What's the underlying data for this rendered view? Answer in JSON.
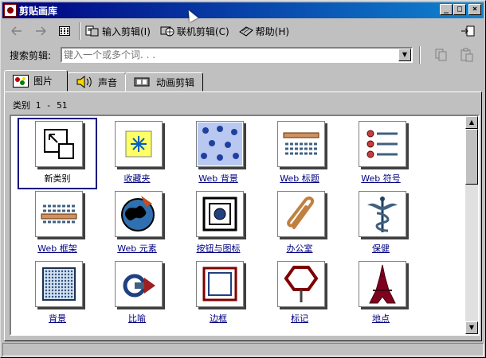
{
  "window": {
    "title": "剪贴画库"
  },
  "title_buttons": {
    "minimize": "_",
    "maximize": "□",
    "close": "×"
  },
  "toolbar": {
    "back_icon": "arrow-left-icon",
    "forward_icon": "arrow-right-icon",
    "thumbnails_icon": "grid-icon",
    "import_label": "输入剪辑(I)",
    "online_label": "联机剪辑(C)",
    "help_label": "帮助(H)",
    "pin_icon": "pin-icon"
  },
  "search": {
    "label": "搜索剪辑:",
    "placeholder": "键入一个或多个词. . ."
  },
  "tabs": [
    {
      "label": "图片"
    },
    {
      "label": "声音"
    },
    {
      "label": "动画剪辑"
    }
  ],
  "panel": {
    "category_label": "类别 1 - 51"
  },
  "categories": [
    {
      "label": "新类别",
      "icon": "new-category-icon"
    },
    {
      "label": "收藏夹",
      "icon": "favorites-icon"
    },
    {
      "label": "Web 背景",
      "icon": "web-background-icon"
    },
    {
      "label": "Web 标题",
      "icon": "web-banner-icon"
    },
    {
      "label": "Web 符号",
      "icon": "web-bullets-icon"
    },
    {
      "label": "Web 框架",
      "icon": "web-frame-icon"
    },
    {
      "label": "Web 元素",
      "icon": "web-elements-icon"
    },
    {
      "label": "按钮与图标",
      "icon": "buttons-icon"
    },
    {
      "label": "办公室",
      "icon": "paperclip-icon"
    },
    {
      "label": "保健",
      "icon": "caduceus-icon"
    },
    {
      "label": "背景",
      "icon": "background-icon"
    },
    {
      "label": "比喻",
      "icon": "metaphor-icon"
    },
    {
      "label": "边框",
      "icon": "border-icon"
    },
    {
      "label": "标记",
      "icon": "sign-icon"
    },
    {
      "label": "地点",
      "icon": "eiffel-tower-icon"
    }
  ]
}
